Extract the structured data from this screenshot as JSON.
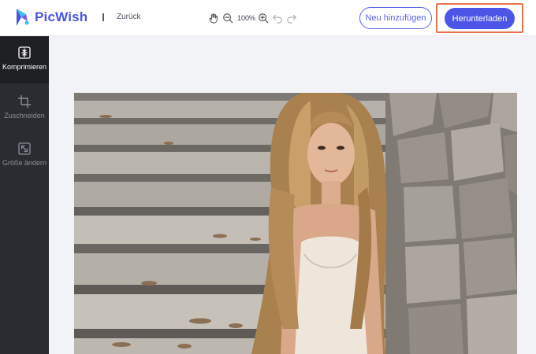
{
  "header": {
    "brand": "PicWish",
    "separator": "I",
    "back_label": "Zurück",
    "zoom_level": "100%",
    "add_new_label": "Neu hinzufügen",
    "download_label": "Herunterladen"
  },
  "sidebar": {
    "items": [
      {
        "label": "Komprimieren",
        "icon": "compress-icon",
        "active": true
      },
      {
        "label": "Zuschneiden",
        "icon": "crop-icon",
        "active": false
      },
      {
        "label": "Größe ändern",
        "icon": "resize-icon",
        "active": false
      }
    ]
  },
  "colors": {
    "brand": "#4a55e0",
    "primary_button": "#4c55e8",
    "highlight_border": "#e8724f",
    "sidebar_bg": "#2b2c31",
    "canvas_bg": "#f2f3f7"
  },
  "toolbar_icons": [
    "hand-icon",
    "zoom-out-icon",
    "zoom-in-icon",
    "undo-icon",
    "redo-icon"
  ]
}
